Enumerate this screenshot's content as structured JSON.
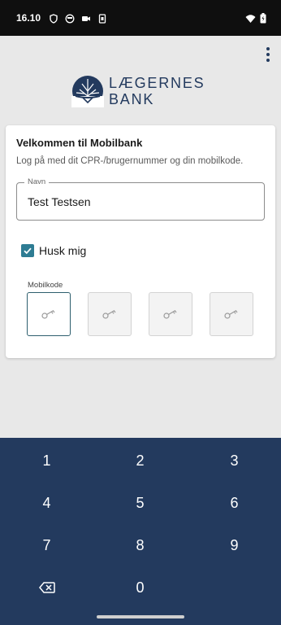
{
  "status_bar": {
    "time": "16.10",
    "left_icons": [
      "shield-icon",
      "smiley-icon",
      "video-icon",
      "sim-icon"
    ],
    "right_icons": [
      "wifi-icon",
      "battery-icon"
    ]
  },
  "app": {
    "menu_icon": "more-vert-icon",
    "logo": {
      "line1": "LÆGERNES",
      "line2": "BANK",
      "mark": "tree-logo-icon"
    },
    "brand_color": "#233a5e",
    "accent_color": "#2e7c93"
  },
  "card": {
    "title": "Velkommen til Mobilbank",
    "subtitle": "Log på med dit CPR-/brugernummer og din mobilkode.",
    "name_field": {
      "label": "Navn",
      "value": "Test Testsen"
    },
    "remember": {
      "label": "Husk mig",
      "checked": true
    },
    "pin": {
      "label": "Mobilkode",
      "boxes": 4,
      "filled": 0,
      "icon": "key-icon"
    }
  },
  "keypad": {
    "keys": [
      "1",
      "2",
      "3",
      "4",
      "5",
      "6",
      "7",
      "8",
      "9",
      "",
      "0"
    ],
    "backspace_icon": "backspace-icon"
  }
}
